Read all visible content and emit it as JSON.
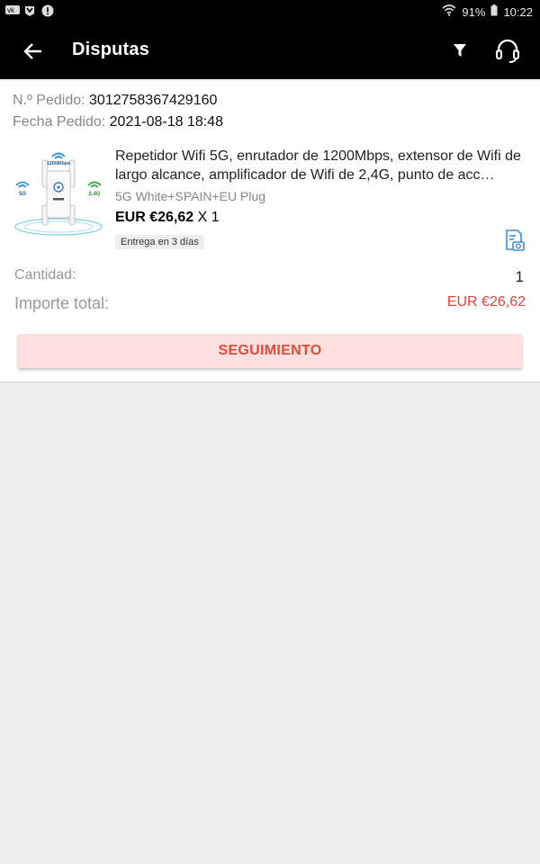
{
  "status_bar": {
    "battery_percent": "91%",
    "time": "10:22",
    "icons": [
      "vk-icon",
      "mi-icon",
      "alert-icon",
      "wifi-icon",
      "battery-icon"
    ]
  },
  "app_bar": {
    "title": "Disputas",
    "icons": [
      "back-arrow-icon",
      "filter-icon",
      "headset-support-icon"
    ]
  },
  "order": {
    "number_label": "N.º Pedido:",
    "number_value": "3012758367429160",
    "date_label": "Fecha Pedido:",
    "date_value": "2021-08-18 18:48"
  },
  "product": {
    "title": "Repetidor Wifi 5G, enrutador de 1200Mbps, extensor de Wifi de largo alcance, amplificador de Wifi de 2,4G, punto de acc…",
    "variant": "5G White+SPAIN+EU Plug",
    "price": "EUR €26,62",
    "quantity_suffix": "X 1",
    "delivery_badge": "Entrega en 3 días",
    "thumb_labels": {
      "speed": "1200Mbps",
      "band_left": "5G",
      "band_right": "2.4G"
    }
  },
  "summary": {
    "quantity_label": "Cantidad:",
    "quantity_value": "1",
    "total_label": "Importe total:",
    "total_value": "EUR €26,62"
  },
  "actions": {
    "tracking_label": "SEGUIMIENTO"
  },
  "colors": {
    "accent_red": "#e64340",
    "button_bg": "#fde0df",
    "app_bar": "#000000"
  }
}
